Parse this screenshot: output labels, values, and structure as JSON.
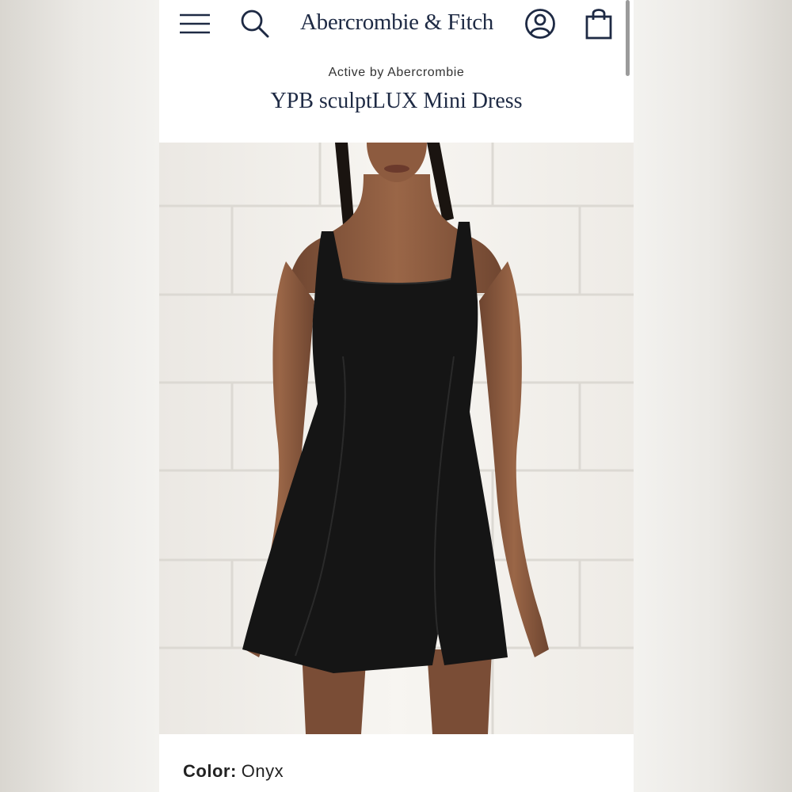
{
  "header": {
    "logo_text": "Abercrombie & Fitch",
    "icons": [
      "menu-icon",
      "search-icon",
      "account-icon",
      "shopping-bag-icon"
    ]
  },
  "product": {
    "brand_line": "Active by Abercrombie",
    "title": "YPB sculptLUX Mini Dress",
    "image_alt": "Model wearing black mini dress against white brick wall",
    "color_label": "Color:",
    "color_value": "Onyx"
  },
  "colors": {
    "brand_navy": "#1e2a44",
    "dress": "#151515",
    "wall": "#f4f2ee",
    "skin": "#8a5a3e"
  }
}
